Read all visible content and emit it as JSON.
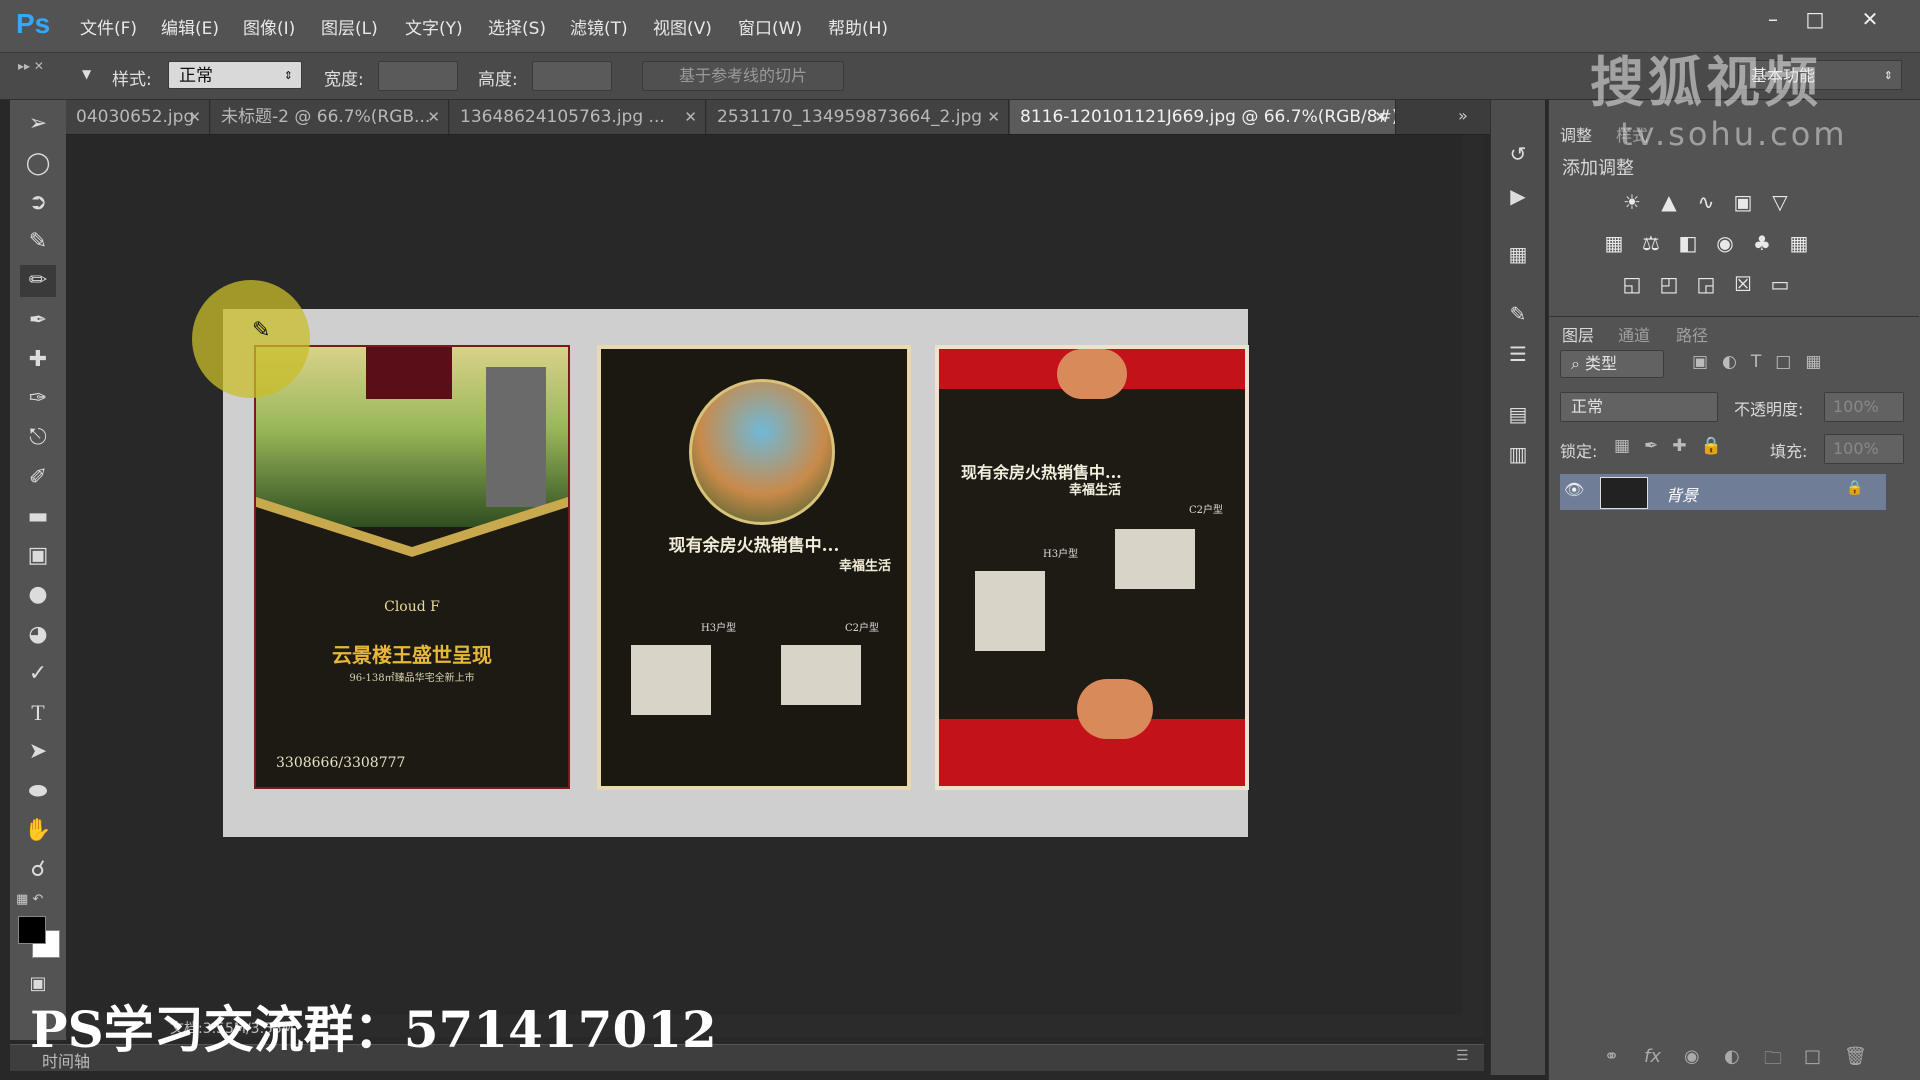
{
  "app": {
    "logo": "Ps"
  },
  "menu": [
    "文件(F)",
    "编辑(E)",
    "图像(I)",
    "图层(L)",
    "文字(Y)",
    "选择(S)",
    "滤镜(T)",
    "视图(V)",
    "窗口(W)",
    "帮助(H)"
  ],
  "options": {
    "style_label": "样式:",
    "style_value": "正常",
    "width_label": "宽度:",
    "height_label": "高度:",
    "slice_button": "基于参考线的切片",
    "workspace": "基本功能"
  },
  "tabs": [
    {
      "label": "04030652.jpg"
    },
    {
      "label": "未标题-2 @ 66.7%(RGB..."
    },
    {
      "label": "13648624105763.jpg ..."
    },
    {
      "label": "2531170_134959873664_2.jpg"
    },
    {
      "label": "8116-120101121J669.jpg @ 66.7%(RGB/8#)"
    }
  ],
  "posters": {
    "p1": {
      "name_en": "Cloud F",
      "headline": "云景楼王盛世呈现",
      "sub": "96-138㎡臻品华宅全新上市",
      "phone": "3308666/3308777"
    },
    "p2": {
      "headline": "现有余房火热销售中...",
      "sub": "幸福生活",
      "type_a": "H3户型",
      "type_b": "C2户型"
    },
    "p3": {
      "headline": "现有余房火热销售中...",
      "sub": "幸福生活",
      "type_a": "H3户型",
      "type_b": "C2户型"
    }
  },
  "adjust_panel": {
    "tab_adjust": "调整",
    "tab_style": "样式",
    "add_adjustment": "添加调整"
  },
  "layers_panel": {
    "tab_layers": "图层",
    "tab_channels": "通道",
    "tab_paths": "路径",
    "filter_kind": "类型",
    "blend_mode": "正常",
    "opacity_label": "不透明度:",
    "opacity_value": "100%",
    "lock_label": "锁定:",
    "fill_label": "填充:",
    "fill_value": "100%",
    "layer_name": "背景"
  },
  "status": {
    "timeline": "时间轴",
    "doc_info": "文档:3.55M/3.55M"
  },
  "watermarks": {
    "sohu": "搜狐视频",
    "url": "tv.sohu.com",
    "group": "PS学习交流群：571417012"
  }
}
